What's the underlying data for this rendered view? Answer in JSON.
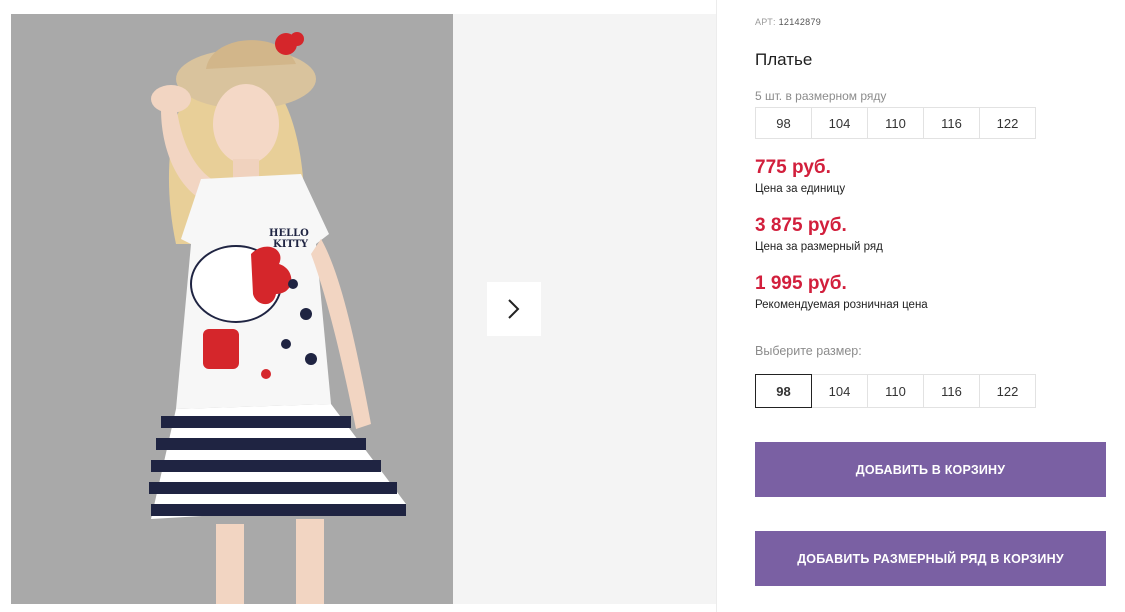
{
  "gallery": {
    "main_image_icon": "photo-girl-in-dress",
    "next_icon": "chevron-right-icon",
    "print_text": "HELLO KITTY"
  },
  "product": {
    "art_label": "АРТ:",
    "art_number": "12142879",
    "title": "Платье",
    "row_note": "5 шт. в размерном ряду",
    "sizes": [
      "98",
      "104",
      "110",
      "116",
      "122"
    ]
  },
  "prices": {
    "unit_price": "775 руб.",
    "unit_label": "Цена за единицу",
    "row_price": "3 875 руб.",
    "row_label": "Цена за размерный ряд",
    "retail_price": "1 995 руб.",
    "retail_label": "Рекомендуемая розничная цена"
  },
  "size_select": {
    "label": "Выберите размер:",
    "options": [
      "98",
      "104",
      "110",
      "116",
      "122"
    ],
    "selected": "98"
  },
  "actions": {
    "add_to_cart": "ДОБАВИТЬ В КОРЗИНУ",
    "add_row_to_cart": "ДОБАВИТЬ РАЗМЕРНЫЙ РЯД В КОРЗИНУ"
  },
  "colors": {
    "accent_button": "#7a60a3",
    "price": "#d21f3c"
  }
}
